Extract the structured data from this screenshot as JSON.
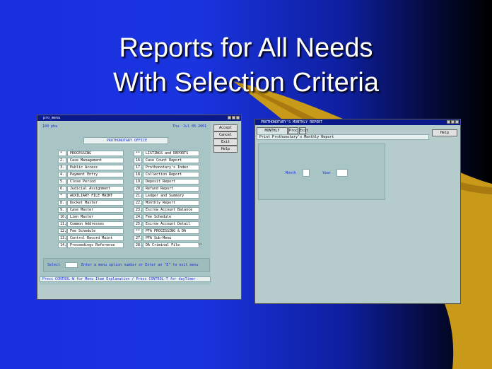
{
  "slide": {
    "title_line1": "Reports for All Needs",
    "title_line2": "With Selection Criteria"
  },
  "left_window": {
    "title": "pro_menu",
    "left_code": "100 pha",
    "date": "Thu. Jul 05.2001",
    "header": "PROTHONOTARY OFFICE",
    "buttons": [
      "Accept",
      "Cancel",
      "Exit",
      "Help"
    ],
    "left_column": [
      {
        "num": "*",
        "label": "PROCESSING"
      },
      {
        "num": "2.",
        "label": "Case Management"
      },
      {
        "num": "3.",
        "label": "Public Access"
      },
      {
        "num": "4.",
        "label": "Payment Entry"
      },
      {
        "num": "5.",
        "label": "Close Period"
      },
      {
        "num": "6.",
        "label": "Judicial Assignment"
      },
      {
        "num": "*",
        "label": "AUXILIARY FILE MAINT"
      },
      {
        "num": "8.",
        "label": "Docket Master"
      },
      {
        "num": "9.",
        "label": "Case Master"
      },
      {
        "num": "10.",
        "label": "Lien Master"
      },
      {
        "num": "11.",
        "label": "Common Addresses"
      },
      {
        "num": "12.",
        "label": "Fee Schedule"
      },
      {
        "num": "13.",
        "label": "Control Record Maint"
      },
      {
        "num": "14.",
        "label": "Proceedings Reference"
      }
    ],
    "right_column": [
      {
        "num": "**",
        "label": "LISTINGS and REPORTS"
      },
      {
        "num": "16.",
        "label": "Case Count Report"
      },
      {
        "num": "17.",
        "label": "Prothonotary's Index"
      },
      {
        "num": "18.",
        "label": "Collection Report"
      },
      {
        "num": "19.",
        "label": "Deposit Report"
      },
      {
        "num": "20.",
        "label": "Refund Report"
      },
      {
        "num": "21.",
        "label": "Ledger and Summary"
      },
      {
        "num": "22.",
        "label": "Monthly Report"
      },
      {
        "num": "23.",
        "label": "Escrow Account Balance"
      },
      {
        "num": "24.",
        "label": "Fee Schedule"
      },
      {
        "num": "25.",
        "label": "Escrow Account Detail"
      },
      {
        "num": "**",
        "label": "PFA PROCESSING & DA"
      },
      {
        "num": "27.",
        "label": "PFA Sub-Menu"
      },
      {
        "num": "28.",
        "label": "DA Criminal File"
      }
    ],
    "more_arrow": ">>",
    "select_label": "Select",
    "select_hint": "Enter a menu option number  or  Enter an \"E\" to exit menu",
    "footer": "Press CONTROL-W for Menu Item Explanation / Press CONTROL-T for dayTimer"
  },
  "right_window": {
    "title": "PROTHONOTARY'S MONTHLY REPORT",
    "menu": [
      "MONTHLY REPORT",
      "Proc",
      "Exit"
    ],
    "description": "Print Prothonotary's Monthly Report",
    "help_button": "Help",
    "month_label": "Month",
    "year_label": "Year"
  }
}
